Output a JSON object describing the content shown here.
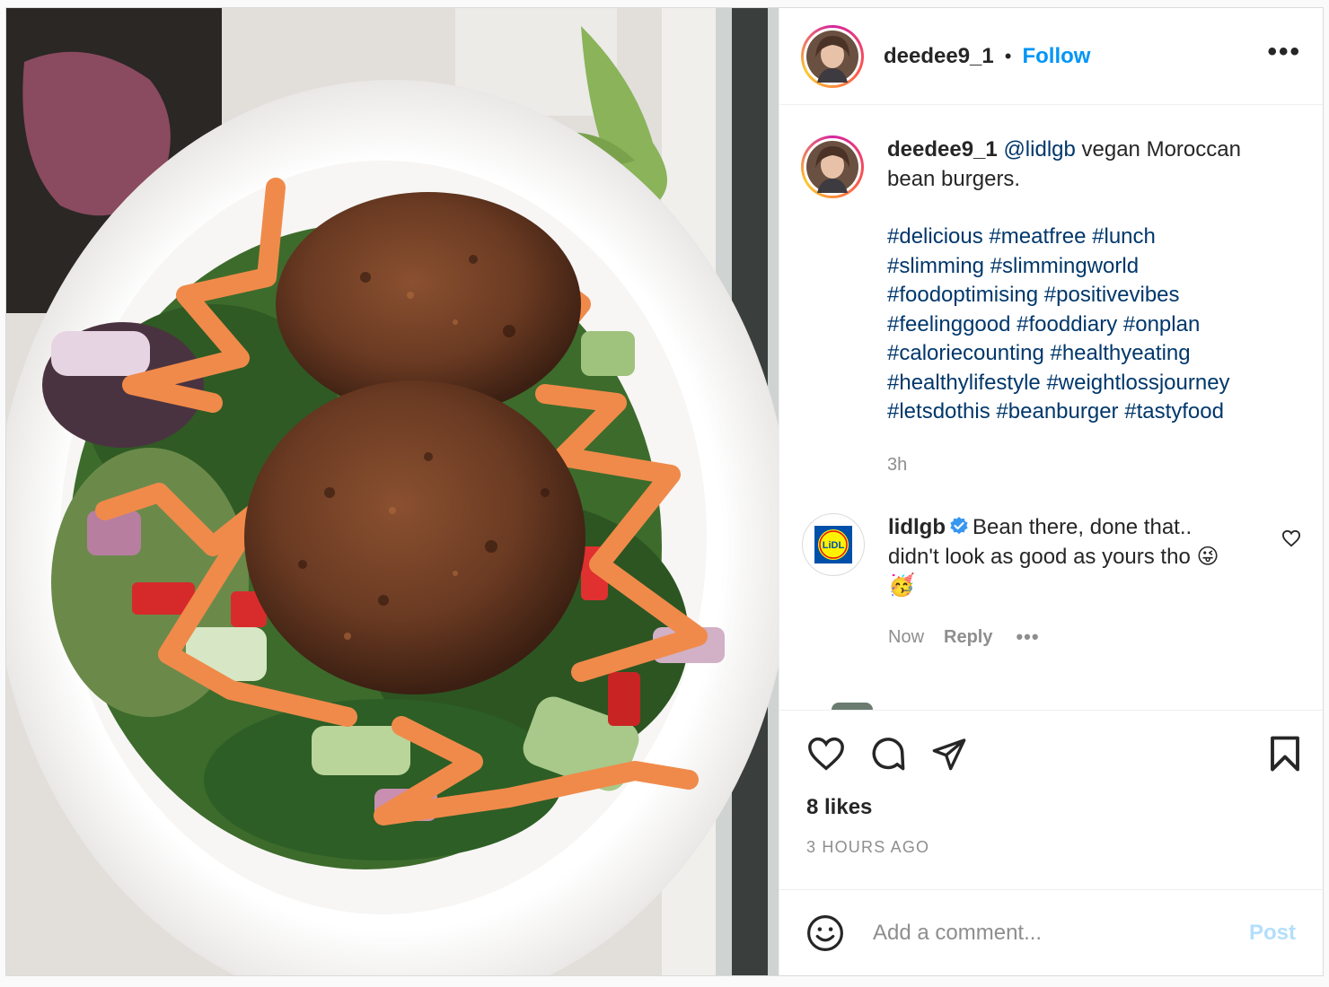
{
  "header": {
    "username": "deedee9_1",
    "separator": "•",
    "follow_label": "Follow",
    "more_label": "•••",
    "avatar_icon": "profile-photo"
  },
  "caption": {
    "username": "deedee9_1",
    "mention": "@lidlgb",
    "text": " vegan Moroccan bean burgers.",
    "hashtags": [
      "#delicious",
      "#meatfree",
      "#lunch",
      "#slimming",
      "#slimmingworld",
      "#foodoptimising",
      "#positivevibes",
      "#feelinggood",
      "#fooddiary",
      "#onplan",
      "#caloriecounting",
      "#healthyeating",
      "#healthylifestyle",
      "#weightlossjourney",
      "#letsdothis",
      "#beanburger",
      "#tastyfood"
    ],
    "time": "3h"
  },
  "comment": {
    "username": "lidlgb",
    "verified_icon": "verified-badge-icon",
    "text": "Bean there, done that.. didn't look as good as yours tho 😜 🥳",
    "logo_text": "LiDL",
    "time": "Now",
    "reply_label": "Reply",
    "more_label": "•••"
  },
  "actions": {
    "icons": [
      "heart-icon",
      "comment-icon",
      "share-icon",
      "bookmark-icon"
    ],
    "likes": "8 likes",
    "time_ago": "3 HOURS AGO"
  },
  "add_comment": {
    "placeholder": "Add a comment...",
    "post_label": "Post",
    "emoji_icon": "smiley-icon"
  },
  "colors": {
    "link": "#0095f6",
    "hashtag": "#00376b",
    "post_disabled": "#b2dffc",
    "muted": "#8e8e8e",
    "verified": "#3897f0"
  }
}
